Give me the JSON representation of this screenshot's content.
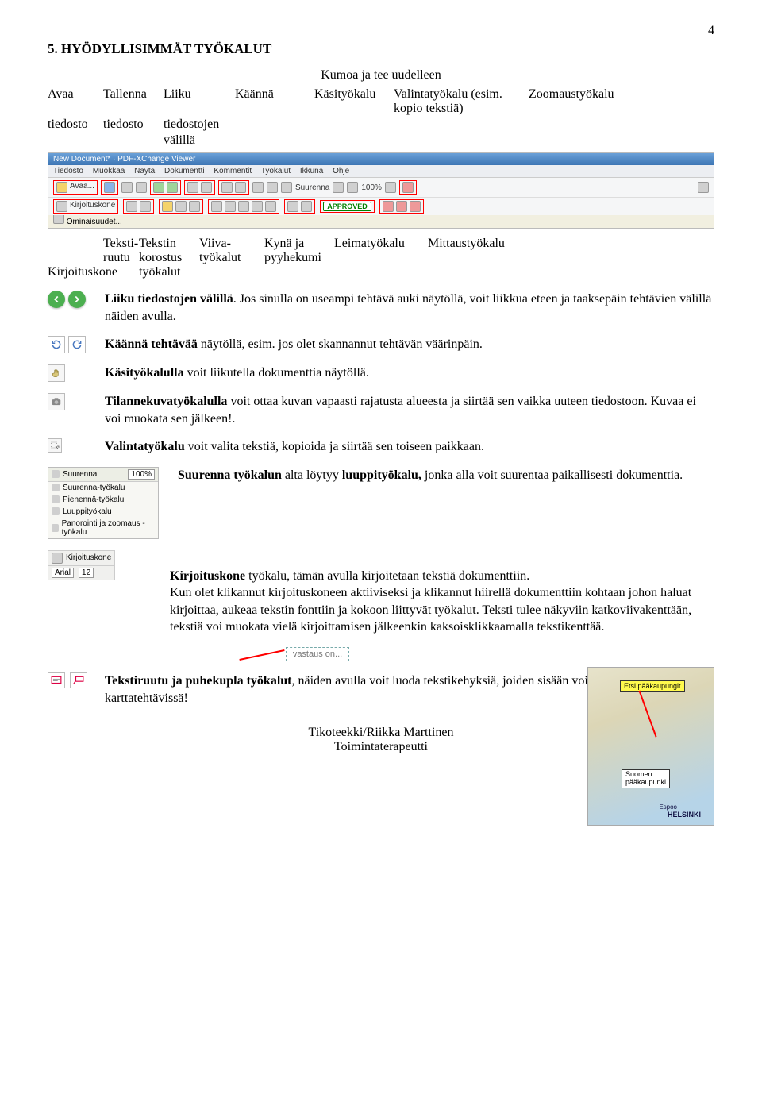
{
  "page_number": "4",
  "heading": "5. HYÖDYLLISIMMÄT TYÖKALUT",
  "centered_undo": "Kumoa ja tee uudelleen",
  "upper_labels": {
    "l1a": "Avaa",
    "l1b": "tiedosto",
    "l2a": "Tallenna",
    "l2b": "tiedosto",
    "l3a": "Liiku",
    "l3b": "tiedostojen",
    "l3c": "välillä",
    "l4": "Käännä",
    "l5": "Käsityökalu",
    "l6": "Valintatyökalu (esim. kopio tekstiä)",
    "l7": "Zoomaustyökalu"
  },
  "toolbar": {
    "title": "New Document* · PDF-XChange Viewer",
    "menu": [
      "Tiedosto",
      "Muokkaa",
      "Näytä",
      "Dokumentti",
      "Kommentit",
      "Työkalut",
      "Ikkuna",
      "Ohje"
    ],
    "open": "Avaa...",
    "zoom_label": "Suurenna",
    "zoom_value": "100%",
    "approved": "APPROVED",
    "typewriter_label": "Kirjoituskone",
    "properties": "Ominaisuudet..."
  },
  "lower_labels": {
    "d1a": "Teksti-",
    "d1b": "ruutu",
    "d2a": "Kirjoituskone",
    "d3a": "Tekstin",
    "d3b": "korostus",
    "d3c": "työkalut",
    "d4a": "Viiva-",
    "d4b": "työkalut",
    "d5a": "Kynä ja",
    "d5b": "pyyhekumi",
    "d6a": "Leimatyökalu",
    "d7a": "Mittaustyökalu"
  },
  "items": {
    "liiku": {
      "bold": "Liiku tiedostojen välillä",
      "text": ". Jos sinulla on useampi tehtävä auki näytöllä, voit liikkua eteen ja taaksepäin tehtävien välillä näiden avulla."
    },
    "kaanna": {
      "bold": "Käännä tehtävää",
      "text": " näytöllä, esim. jos olet skannannut tehtävän väärinpäin."
    },
    "kasityokalu": {
      "bold": "Käsityökalulla",
      "text": " voit liikutella dokumenttia näytöllä."
    },
    "tilannekuva": {
      "bold": "Tilannekuvatyökalulla",
      "text": " voit ottaa kuvan vapaasti rajatusta alueesta ja siirtää sen vaikka uuteen tiedostoon. Kuvaa ei voi muokata sen jälkeen!."
    },
    "valinta": {
      "bold": "Valintatyökalu",
      "text": " voit valita tekstiä, kopioida ja siirtää sen toiseen paikkaan."
    },
    "suurenna": {
      "bold1": "Suurenna työkalun",
      "mid": " alta löytyy ",
      "bold2": "luuppityökalu,",
      "text": " jonka alla voit suurentaa paikallisesti dokumenttia."
    },
    "kirjoituskone": {
      "bold": "Kirjoituskone",
      "text": " työkalu, tämän avulla kirjoitetaan tekstiä dokumenttiin.\nKun olet klikannut kirjoituskoneen aktiiviseksi ja klikannut hiirellä dokumenttiin kohtaan johon haluat kirjoittaa, aukeaa tekstin fonttiin ja kokoon liittyvät työkalut. Teksti tulee näkyviin katkoviivakenttään, tekstiä voi muokata vielä kirjoittamisen jälkeenkin kaksoisklikkaamalla tekstikenttää."
    },
    "vastaus": "vastaus on...",
    "tekstiruutu": {
      "bold": "Tekstiruutu ja puhekupla työkalut",
      "text": ", näiden avulla voit luoda tekstikehyksiä, joiden sisään voi kirjoittaa. Hyvä karttatehtävissä!"
    },
    "font_name": "Arial",
    "font_size": "12"
  },
  "zoom_menu": {
    "head_label": "Suurenna",
    "head_value": "100%",
    "i1": "Suurenna-työkalu",
    "i2": "Pienennä-työkalu",
    "i3": "Luuppityökalu",
    "i4": "Panorointi ja zoomaus -työkalu"
  },
  "map": {
    "box1": "Etsi pääkaupungit",
    "box2a": "Suomen",
    "box2b": "pääkaupunki",
    "helsinki": "HELSINKI",
    "espoo": "Espoo"
  },
  "footer1": "Tikoteekki/Riikka Marttinen",
  "footer2": "Toimintaterapeutti"
}
